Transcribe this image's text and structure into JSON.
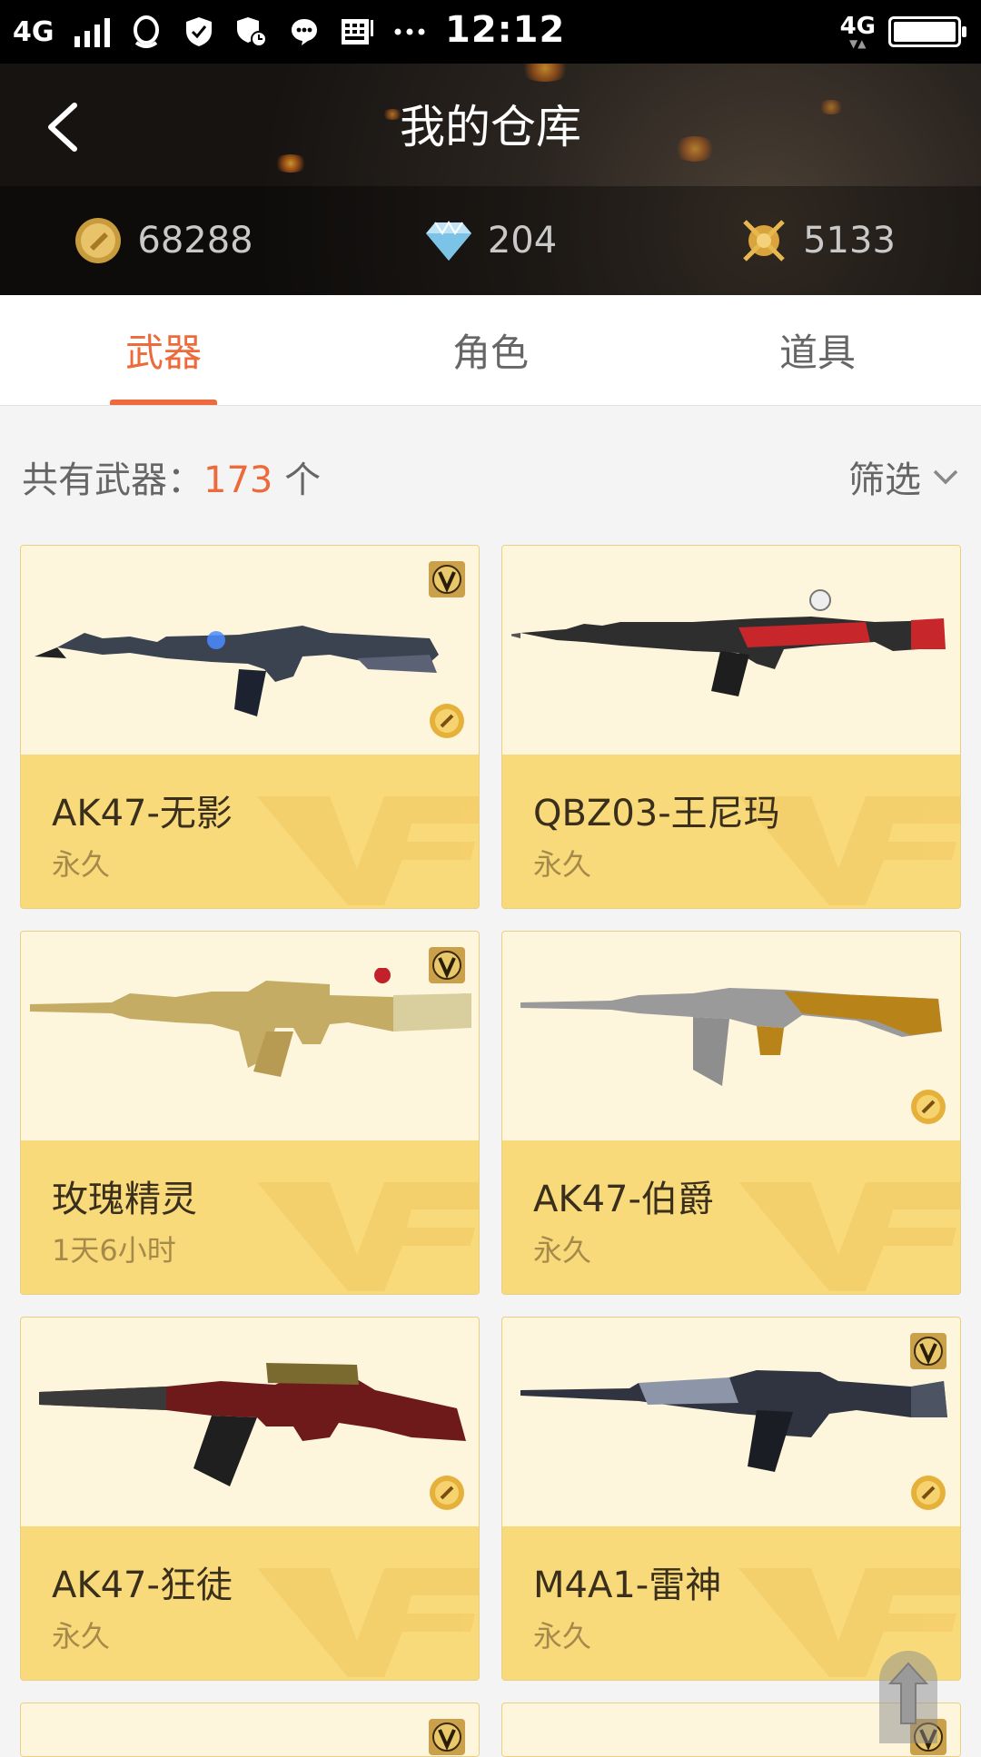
{
  "status_bar": {
    "network": "4G",
    "network2": "4G",
    "time": "12:12",
    "icons": [
      "qq-icon",
      "shield-icon",
      "security-icon",
      "message-icon",
      "keyboard-icon",
      "more-dots-icon"
    ]
  },
  "header": {
    "title": "我的仓库",
    "back_icon": "chevron-left-icon"
  },
  "currency": [
    {
      "icon": "gold-coin-icon",
      "value": "68288"
    },
    {
      "icon": "diamond-icon",
      "value": "204"
    },
    {
      "icon": "crossed-swords-icon",
      "value": "5133"
    }
  ],
  "tabs": [
    {
      "label": "武器",
      "active": true
    },
    {
      "label": "角色",
      "active": false
    },
    {
      "label": "道具",
      "active": false
    }
  ],
  "summary": {
    "prefix": "共有武器：",
    "count": "173",
    "suffix": " 个",
    "filter_label": "筛选"
  },
  "weapons": [
    {
      "name": "AK47-无影",
      "duration": "永久",
      "vip": true,
      "coin": true
    },
    {
      "name": "QBZ03-王尼玛",
      "duration": "永久",
      "vip": false,
      "coin": false
    },
    {
      "name": "玫瑰精灵",
      "duration": "1天6小时",
      "vip": true,
      "coin": false
    },
    {
      "name": "AK47-伯爵",
      "duration": "永久",
      "vip": false,
      "coin": true
    },
    {
      "name": "AK47-狂徒",
      "duration": "永久",
      "vip": false,
      "coin": true
    },
    {
      "name": "M4A1-雷神",
      "duration": "永久",
      "vip": true,
      "coin": true
    }
  ],
  "colors": {
    "accent": "#ec6a3b",
    "card_top": "#fdf6dc",
    "card_bottom": "#f8da7b"
  }
}
